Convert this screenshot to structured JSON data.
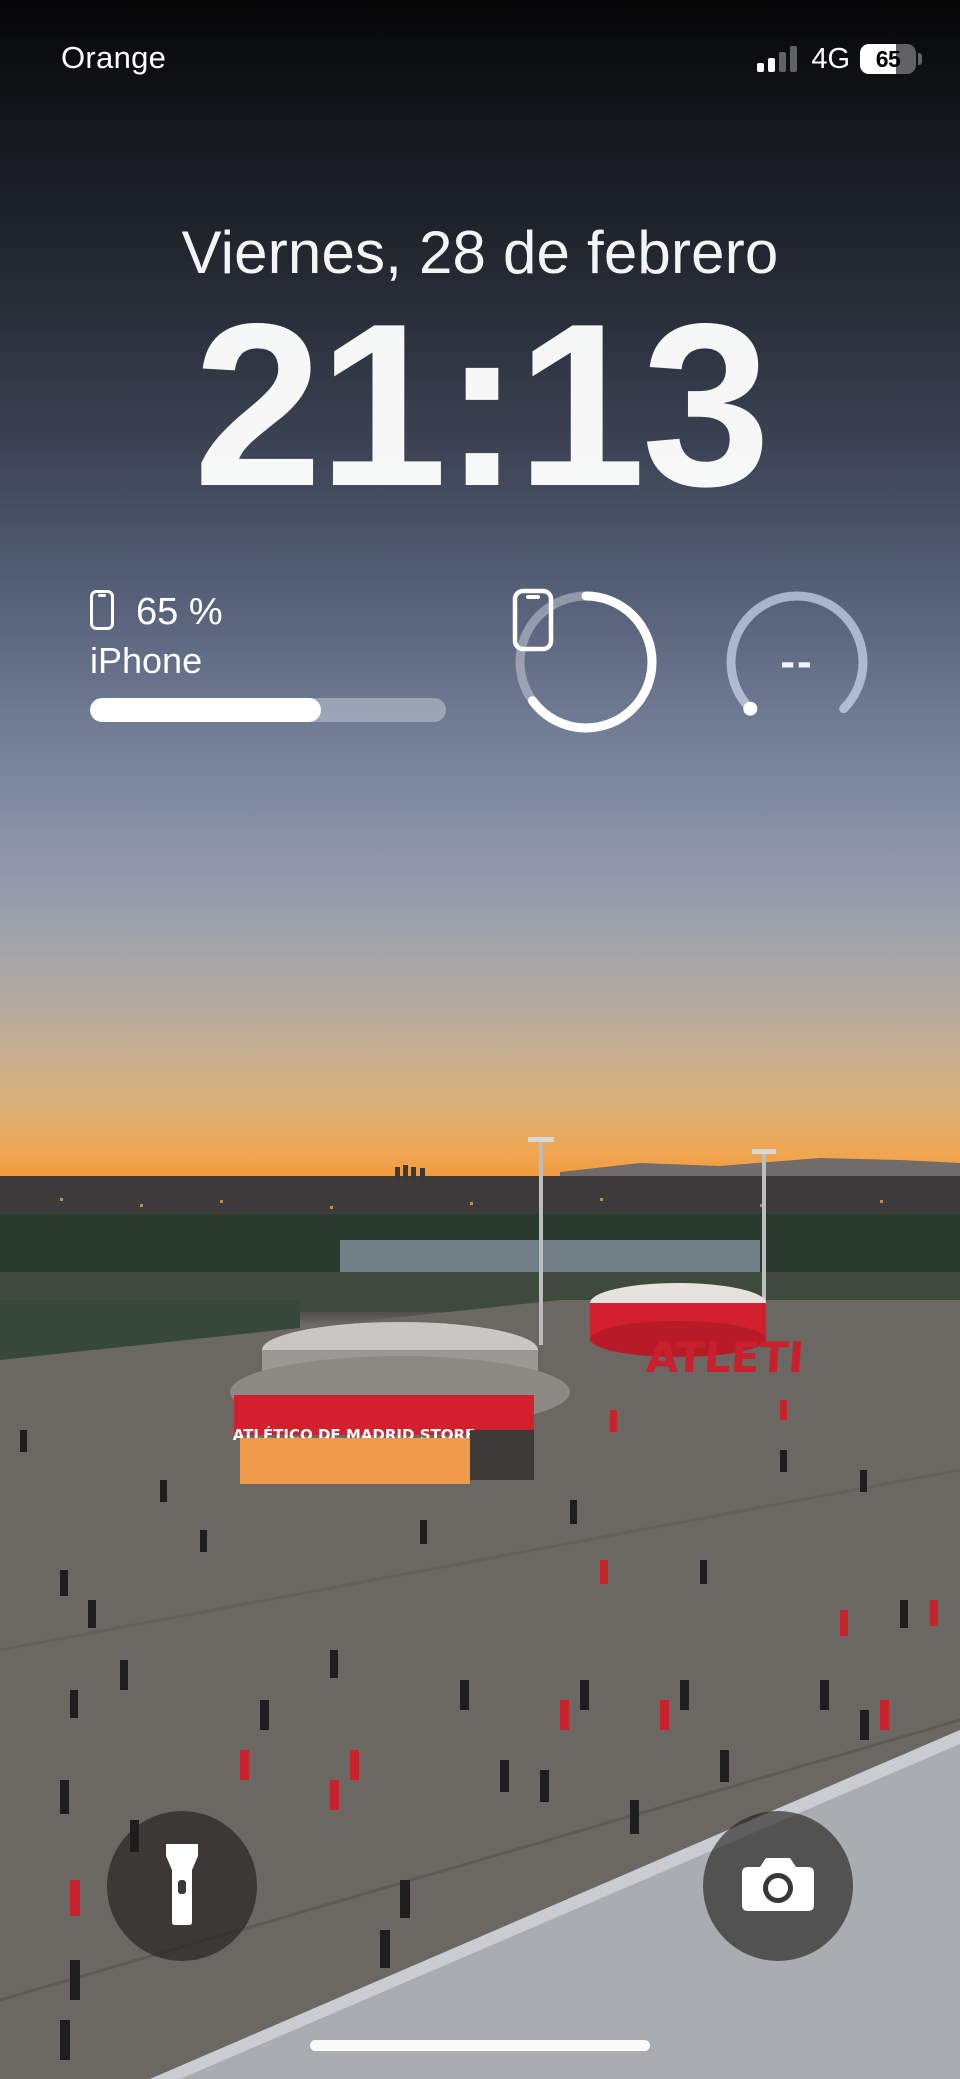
{
  "status_bar": {
    "carrier": "Orange",
    "network": "4G",
    "battery_percent_label": "65",
    "battery_level": 0.65,
    "signal_bars_active": 2,
    "signal_bars_total": 4
  },
  "lock_screen": {
    "date": "Viernes, 28 de febrero",
    "time": "21:13"
  },
  "widgets": {
    "battery": {
      "percent_label": "65 %",
      "device_name": "iPhone",
      "level": 0.65,
      "icon": "iphone-icon"
    },
    "phone_ring": {
      "icon": "iphone-icon",
      "level": 0.65
    },
    "second_ring": {
      "value": "--"
    }
  },
  "wallpaper": {
    "store_sign": "ATLÉTICO DE MADRID STORE",
    "big_letters": "ATLETI"
  },
  "controls": {
    "flashlight_icon": "flashlight-icon",
    "camera_icon": "camera-icon"
  },
  "colors": {
    "accent_white": "#ffffff",
    "sky_orange": "#f29a3a",
    "atletico_red": "#d2202e"
  }
}
